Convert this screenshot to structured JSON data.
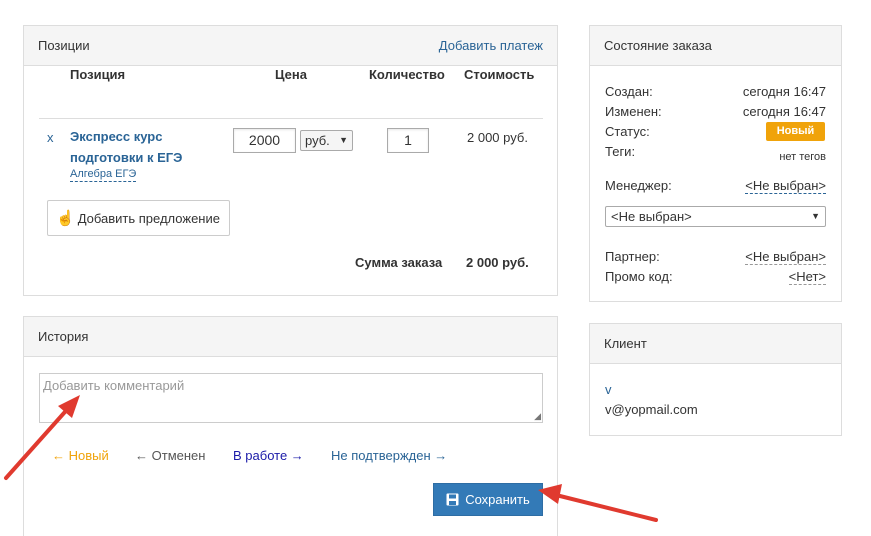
{
  "positions": {
    "title": "Позиции",
    "add_payment": "Добавить платеж",
    "columns": {
      "position": "Позиция",
      "price": "Цена",
      "quantity": "Количество",
      "cost": "Стоимость"
    },
    "items": [
      {
        "remove": "x",
        "name_line1": "Экспресс курс",
        "name_line2": "подготовки к ЕГЭ",
        "category": "Алгебра ЕГЭ",
        "price": "2000",
        "currency": "руб.",
        "quantity": "1",
        "cost": "2 000 руб."
      }
    ],
    "add_offer": "Добавить предложение",
    "total_label": "Сумма заказа",
    "total_value": "2 000 руб."
  },
  "order_state": {
    "title": "Состояние заказа",
    "created_label": "Создан:",
    "created_value": "сегодня 16:47",
    "modified_label": "Изменен:",
    "modified_value": "сегодня 16:47",
    "status_label": "Статус:",
    "status_value": "Новый",
    "status_color": "#f0a30a",
    "tags_label": "Теги:",
    "tags_value": "нет тегов",
    "manager_label": "Менеджер:",
    "manager_value": "<Не выбран>",
    "manager_select": "<Не выбран>",
    "partner_label": "Партнер:",
    "partner_value": "<Не выбран>",
    "promo_label": "Промо код:",
    "promo_value": "<Нет>"
  },
  "client": {
    "title": "Клиент",
    "name": "v",
    "email": "v@yopmail.com"
  },
  "history": {
    "title": "История",
    "comment_placeholder": "Добавить комментарий",
    "statuses": [
      {
        "label": "Новый",
        "arrow": "←",
        "color": "#f0a30a"
      },
      {
        "label": "Отменен",
        "arrow": "←",
        "color": "#555555"
      },
      {
        "label": "В работе",
        "arrow": "→",
        "color": "#1a1aa8"
      },
      {
        "label": "Не подтвержден",
        "arrow": "→",
        "color": "#2a6496"
      }
    ],
    "save_label": "Сохранить"
  },
  "colors": {
    "primary": "#337ab7",
    "annotation_arrow": "#e03a2f"
  }
}
